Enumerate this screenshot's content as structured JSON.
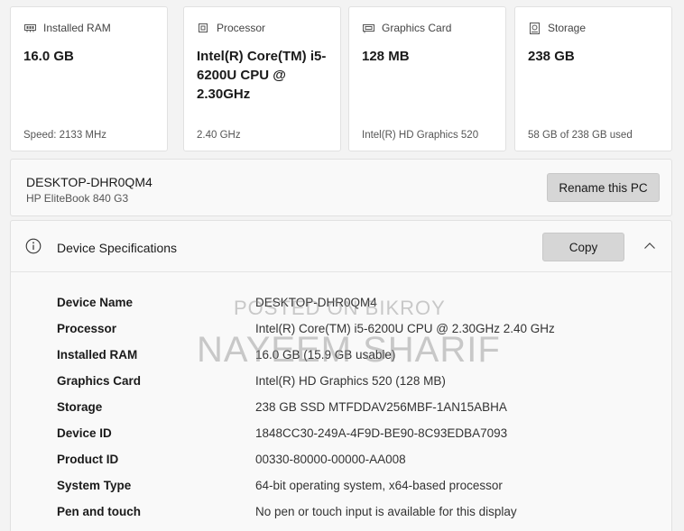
{
  "tiles": [
    {
      "icon": "ram-icon",
      "title": "Installed RAM",
      "value": "16.0 GB",
      "sub": "Speed: 2133 MHz"
    },
    {
      "icon": "processor-icon",
      "title": "Processor",
      "value": "Intel(R) Core(TM) i5-6200U CPU @ 2.30GHz",
      "sub": "2.40 GHz"
    },
    {
      "icon": "graphics-card-icon",
      "title": "Graphics Card",
      "value": "128 MB",
      "sub": "Intel(R) HD Graphics 520"
    },
    {
      "icon": "storage-icon",
      "title": "Storage",
      "value": "238 GB",
      "sub": "58 GB of 238 GB used"
    }
  ],
  "pc": {
    "name": "DESKTOP-DHR0QM4",
    "model": "HP EliteBook 840 G3",
    "rename_label": "Rename this PC"
  },
  "specs": {
    "title": "Device Specifications",
    "copy_label": "Copy",
    "rows": [
      {
        "label": "Device Name",
        "value": "DESKTOP-DHR0QM4"
      },
      {
        "label": "Processor",
        "value": "Intel(R) Core(TM) i5-6200U CPU @ 2.30GHz   2.40 GHz"
      },
      {
        "label": "Installed RAM",
        "value": "16.0 GB (15.9 GB usable)"
      },
      {
        "label": "Graphics Card",
        "value": "Intel(R) HD Graphics 520 (128 MB)"
      },
      {
        "label": "Storage",
        "value": "238 GB SSD MTFDDAV256MBF-1AN15ABHA"
      },
      {
        "label": "Device ID",
        "value": "1848CC30-249A-4F9D-BE90-8C93EDBA7093"
      },
      {
        "label": "Product ID",
        "value": "00330-80000-00000-AA008"
      },
      {
        "label": "System Type",
        "value": "64-bit operating system, x64-based processor"
      },
      {
        "label": "Pen and touch",
        "value": "No pen or touch input is available for this display"
      }
    ]
  },
  "watermark": {
    "line1": "POSTED ON BIKROY",
    "line2": "NAYEEM SHARIF"
  },
  "colors": {
    "background": "#f3f3f3",
    "tile": "#ffffff",
    "button": "#d6d6d6"
  }
}
